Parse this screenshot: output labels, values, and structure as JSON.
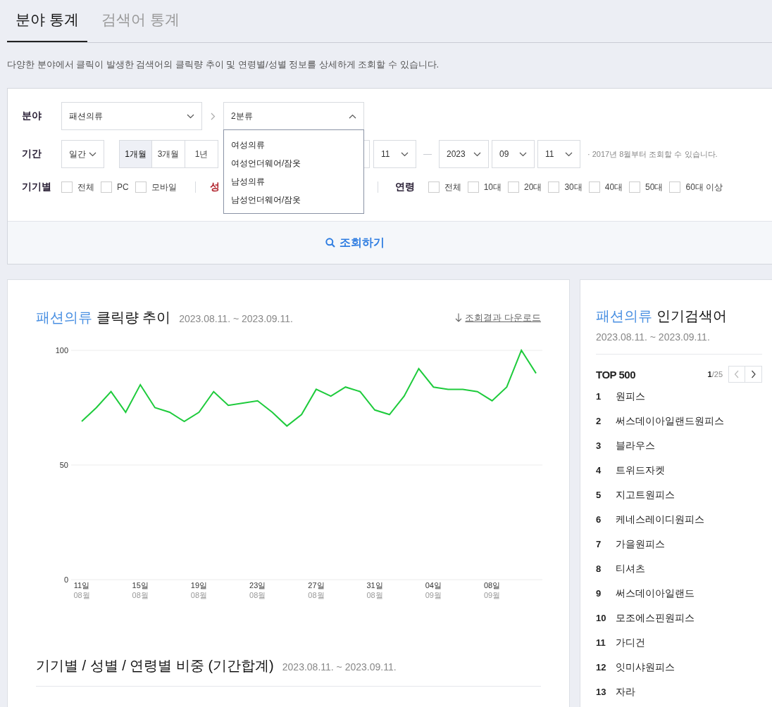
{
  "tabs": [
    {
      "label": "분야 통계",
      "selected": true
    },
    {
      "label": "검색어 통계",
      "selected": false
    }
  ],
  "description": "다양한 분야에서 클릭이 발생한 검색어의 클릭량 추이 및 연령별/성별 정보를 상세하게 조회할 수 있습니다.",
  "filter": {
    "category": {
      "label": "분야",
      "select_1": {
        "value": "패션의류"
      },
      "select_2": {
        "value": "2분류",
        "expanded": true,
        "options": [
          "여성의류",
          "여성언더웨어/잠옷",
          "남성의류",
          "남성언더웨어/잠옷"
        ]
      }
    },
    "period": {
      "label": "기간",
      "unit": "일간",
      "ranges": [
        {
          "label": "1개월",
          "selected": true
        },
        {
          "label": "3개월",
          "selected": false
        },
        {
          "label": "1년",
          "selected": false
        }
      ],
      "start_day": "11",
      "end_year": "2023",
      "end_month": "09",
      "end_day": "11",
      "note": "· 2017년 8월부터 조회할 수 있습니다."
    },
    "device": {
      "label": "기기별",
      "options": [
        {
          "label": "전체",
          "checked": false
        },
        {
          "label": "PC",
          "checked": false
        },
        {
          "label": "모바일",
          "checked": false
        }
      ]
    },
    "gender": {
      "label": "성"
    },
    "age": {
      "label": "연령",
      "options": [
        {
          "label": "전체",
          "checked": false
        },
        {
          "label": "10대",
          "checked": false
        },
        {
          "label": "20대",
          "checked": false
        },
        {
          "label": "30대",
          "checked": false
        },
        {
          "label": "40대",
          "checked": false
        },
        {
          "label": "50대",
          "checked": false
        },
        {
          "label": "60대 이상",
          "checked": false
        }
      ]
    },
    "search_button": "조회하기"
  },
  "trend": {
    "title_category": "패션의류",
    "title": "클릭량 추이",
    "date_range": "2023.08.11. ~ 2023.09.11.",
    "download": "조회결과 다운로드",
    "chart_data": {
      "type": "line",
      "ylim": [
        0,
        100
      ],
      "yticks": [
        0,
        50,
        100
      ],
      "categories": [
        "11일\n08월",
        null,
        null,
        null,
        "15일\n08월",
        null,
        null,
        null,
        "19일\n08월",
        null,
        null,
        null,
        "23일\n08월",
        null,
        null,
        null,
        "27일\n08월",
        null,
        null,
        null,
        "31일\n08월",
        null,
        null,
        null,
        "04일\n09월",
        null,
        null,
        null,
        "08일\n09월",
        null,
        null,
        null
      ],
      "series": [
        {
          "color": "#1ecb3c",
          "values": [
            69,
            75,
            82,
            73,
            85,
            75,
            73,
            69,
            73,
            82,
            76,
            77,
            78,
            73,
            67,
            72,
            83,
            80,
            84,
            82,
            74,
            72,
            80,
            92,
            84,
            83,
            83,
            82,
            78,
            84,
            100,
            90
          ]
        }
      ]
    }
  },
  "ratio": {
    "title": "기기별 / 성별 / 연령별 비중 (기간합계)",
    "date_range": "2023.08.11. ~ 2023.09.11."
  },
  "popular": {
    "title_category": "패션의류",
    "title": "인기검색어",
    "date_range": "2023.08.11. ~ 2023.09.11.",
    "list_title": "TOP 500",
    "page": "1",
    "total_pages": "/25",
    "items": [
      {
        "rank": "1",
        "term": "원피스"
      },
      {
        "rank": "2",
        "term": "써스데이아일랜드원피스"
      },
      {
        "rank": "3",
        "term": "블라우스"
      },
      {
        "rank": "4",
        "term": "트위드자켓"
      },
      {
        "rank": "5",
        "term": "지고트원피스"
      },
      {
        "rank": "6",
        "term": "케네스레이디원피스"
      },
      {
        "rank": "7",
        "term": "가을원피스"
      },
      {
        "rank": "8",
        "term": "티셔츠"
      },
      {
        "rank": "9",
        "term": "써스데이아일랜드"
      },
      {
        "rank": "10",
        "term": "모조에스핀원피스"
      },
      {
        "rank": "11",
        "term": "가디건"
      },
      {
        "rank": "12",
        "term": "잇미샤원피스"
      },
      {
        "rank": "13",
        "term": "자라"
      }
    ]
  }
}
